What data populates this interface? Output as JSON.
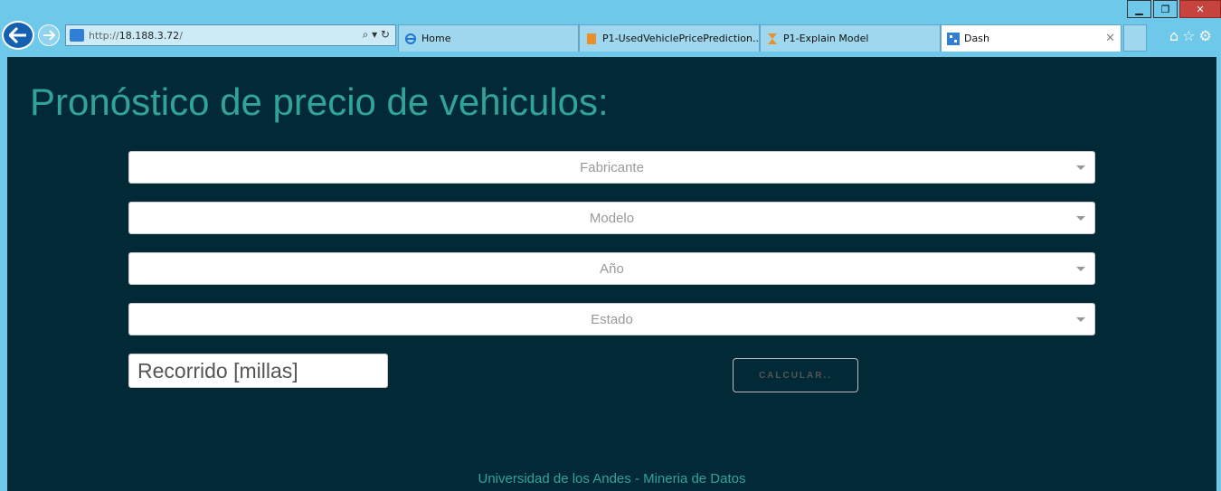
{
  "browser": {
    "address": {
      "proto": "http://",
      "host": "18.188.3.72",
      "path": "/"
    },
    "tabs": [
      {
        "label": "Home",
        "icon": "ie-icon"
      },
      {
        "label": "P1-UsedVehiclePricePrediction...",
        "icon": "notebook-icon"
      },
      {
        "label": "P1-Explain Model",
        "icon": "hourglass-icon"
      },
      {
        "label": "Dash",
        "icon": "dash-icon",
        "active": true
      }
    ]
  },
  "page": {
    "title": "Pronóstico de precio de vehiculos:",
    "dropdowns": [
      {
        "placeholder": "Fabricante"
      },
      {
        "placeholder": "Modelo"
      },
      {
        "placeholder": "Año"
      },
      {
        "placeholder": "Estado"
      }
    ],
    "mileage_input": {
      "placeholder": "Recorrido [millas]"
    },
    "calculate_button": "CALCULAR..",
    "footer": "Universidad de los Andes - Mineria de Datos"
  },
  "colors": {
    "page_bg": "#022a36",
    "accent": "#31a39a",
    "chrome": "#6dc8ea"
  }
}
